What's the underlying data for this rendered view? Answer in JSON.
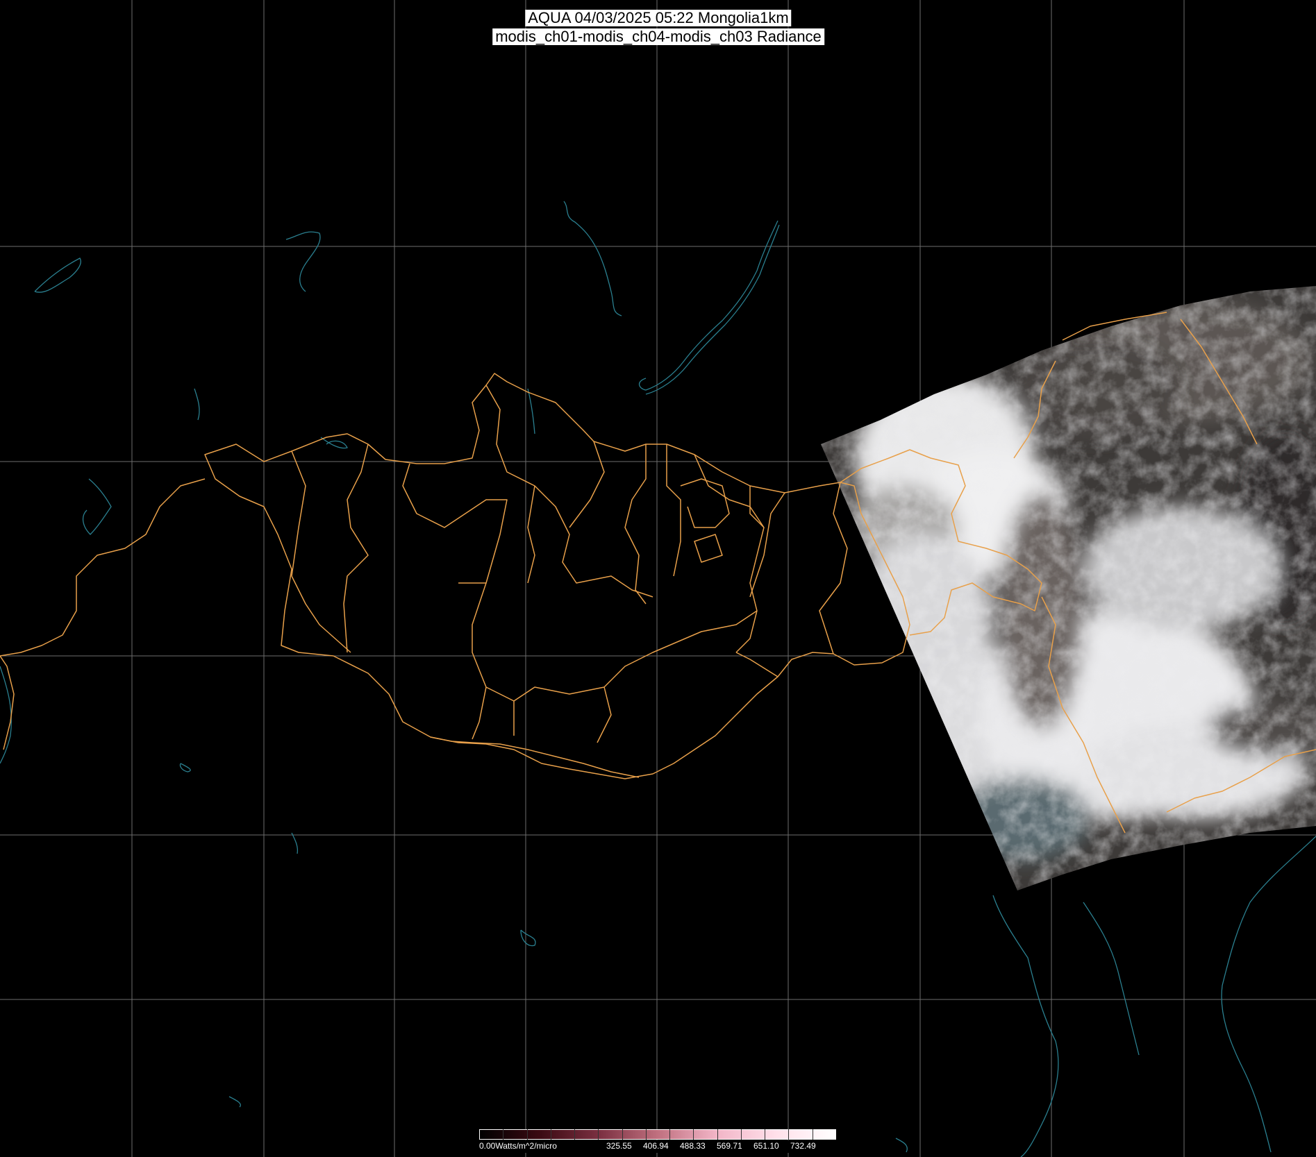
{
  "title": {
    "line1": "AQUA 04/03/2025 05:22 Mongolia1km",
    "line2": "modis_ch01-modis_ch04-modis_ch03 Radiance"
  },
  "colorbar": {
    "unit_label": "0.00Watts/m^2/micro",
    "tick_labels": [
      "325.55",
      "406.94",
      "488.33",
      "569.71",
      "651.10",
      "732.49"
    ],
    "colors": [
      "#000000",
      "#3a0a12",
      "#7a2f40",
      "#c0707f",
      "#f2b5c7",
      "#ffe0ea",
      "#ffffff"
    ]
  },
  "map": {
    "background_color": "#000000",
    "grid_color": "#6e6e6e",
    "boundary_color": "#e8a04a",
    "water_color": "#2a7f8f",
    "swath_description": "MODIS true-color radiance swath over northeast China"
  }
}
